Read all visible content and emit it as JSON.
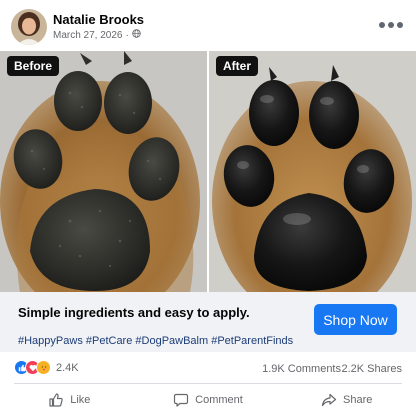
{
  "post": {
    "author": "Natalie Brooks",
    "date": "March 27, 2026",
    "privacy_icon": "globe-icon",
    "more_icon": "more-dots-icon"
  },
  "images": {
    "before_label": "Before",
    "after_label": "After"
  },
  "cta": {
    "headline": "Simple ingredients and easy to apply.",
    "hashtags": "#HappyPaws #PetCare #DogPawBalm #PetParentFinds",
    "button_label": "Shop Now",
    "button_color": "#1877f2"
  },
  "stats": {
    "reaction_icons": [
      "like-icon",
      "love-icon",
      "care-icon"
    ],
    "reactions": "2.4K",
    "comments": "1.9K Comments",
    "shares": "2.2K Shares"
  },
  "actions": {
    "like": "Like",
    "comment": "Comment",
    "share": "Share"
  }
}
